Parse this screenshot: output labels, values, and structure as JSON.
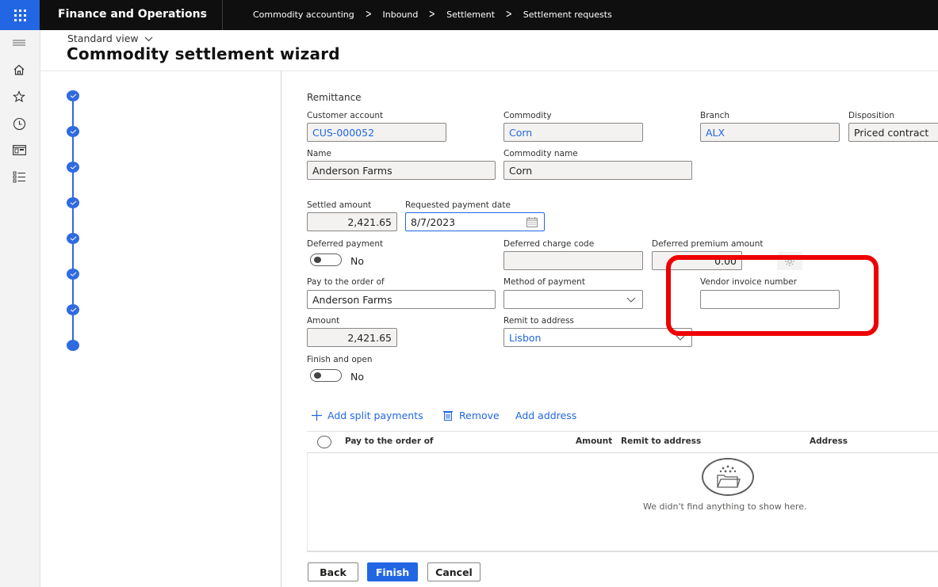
{
  "topbar": {
    "app_title": "Finance and Operations",
    "breadcrumb": [
      "Commodity accounting",
      "Inbound",
      "Settlement",
      "Settlement requests"
    ]
  },
  "nav_rail": {
    "icons": [
      "hamburger-icon",
      "home-icon",
      "star-icon",
      "clock-icon",
      "workspace-icon",
      "list-icon"
    ]
  },
  "header": {
    "view_selector": "Standard view",
    "title": "Commodity settlement wizard"
  },
  "wizard_steps": {
    "total": 8,
    "completed": 7,
    "current_index": 7
  },
  "form": {
    "section_title": "Remittance",
    "customer_account": {
      "label": "Customer account",
      "value": "CUS-000052"
    },
    "commodity": {
      "label": "Commodity",
      "value": "Corn"
    },
    "branch": {
      "label": "Branch",
      "value": "ALX"
    },
    "disposition": {
      "label": "Disposition",
      "value": "Priced contract"
    },
    "name": {
      "label": "Name",
      "value": "Anderson Farms"
    },
    "commodity_name": {
      "label": "Commodity name",
      "value": "Corn"
    },
    "settled_amount": {
      "label": "Settled amount",
      "value": "2,421.65"
    },
    "requested_payment_date": {
      "label": "Requested payment date",
      "value": "8/7/2023"
    },
    "deferred_payment": {
      "label": "Deferred payment",
      "value": "No"
    },
    "deferred_charge_code": {
      "label": "Deferred charge code",
      "value": ""
    },
    "deferred_premium_amount": {
      "label": "Deferred premium amount",
      "value": "0.00"
    },
    "pay_to_order_of": {
      "label": "Pay to the order of",
      "value": "Anderson Farms"
    },
    "method_of_payment": {
      "label": "Method of payment",
      "value": ""
    },
    "vendor_invoice_number": {
      "label": "Vendor invoice number",
      "value": ""
    },
    "amount": {
      "label": "Amount",
      "value": "2,421.65"
    },
    "remit_to_address": {
      "label": "Remit to address",
      "value": "Lisbon"
    },
    "finish_and_open": {
      "label": "Finish and open",
      "value": "No"
    }
  },
  "actions": {
    "add_split_payments": "Add split payments",
    "remove": "Remove",
    "add_address": "Add address"
  },
  "grid": {
    "columns": [
      "Pay to the order of",
      "Amount",
      "Remit to address",
      "Address"
    ],
    "rows": [],
    "empty_message": "We didn't find anything to show here."
  },
  "footer": {
    "back": "Back",
    "finish": "Finish",
    "cancel": "Cancel"
  },
  "annotation": {
    "highlight_color": "#ee0000",
    "highlighted_field": "vendor_invoice_number"
  },
  "colors": {
    "accent": "#2266e3",
    "topbar": "#0f0f0f",
    "step": "#2f6ae0"
  }
}
